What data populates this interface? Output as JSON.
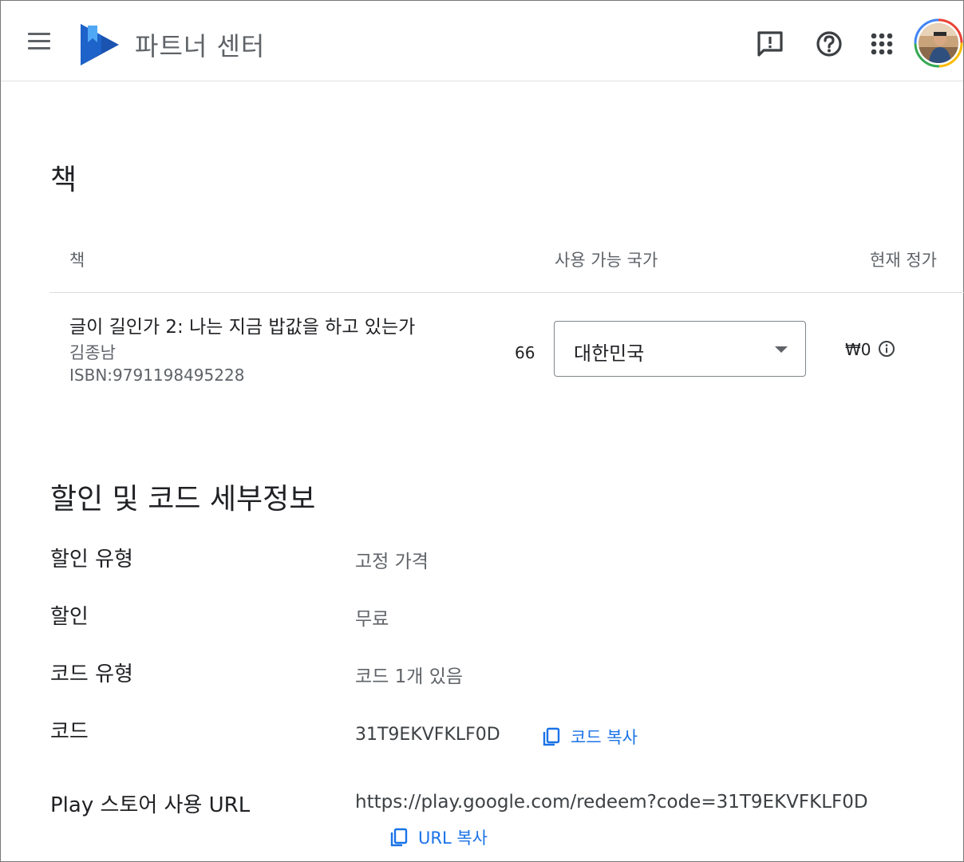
{
  "header": {
    "title": "파트너 센터",
    "icons": [
      "menu-icon",
      "feedback-icon",
      "help-icon",
      "apps-grid-icon",
      "account-avatar"
    ]
  },
  "books_section": {
    "title": "책",
    "columns": [
      "책",
      "사용 가능 국가",
      "현재 정가"
    ],
    "row": {
      "title": "글이 길인가 2: 나는 지금 밥값을 하고 있는가",
      "author": "김종남",
      "isbn": "ISBN:9791198495228",
      "count": "66",
      "country": "대한민국",
      "price": "₩0"
    }
  },
  "discount_section": {
    "title": "할인 및 코드 세부정보",
    "rows": [
      {
        "label": "할인 유형",
        "value": "고정 가격"
      },
      {
        "label": "할인",
        "value": "무료"
      },
      {
        "label": "코드 유형",
        "value": "코드 1개 있음"
      },
      {
        "label": "코드",
        "value": "31T9EKVFKLF0D"
      },
      {
        "label": "Play 스토어 사용 URL",
        "value": "https://play.google.com/redeem?code=31T9EKVFKLF0D"
      }
    ],
    "copy_code_label": "코드 복사",
    "copy_url_label": "URL 복사"
  },
  "colors": {
    "link": "#1a73e8",
    "logo_dark": "#1a53b0",
    "logo_light": "#4285f4"
  }
}
